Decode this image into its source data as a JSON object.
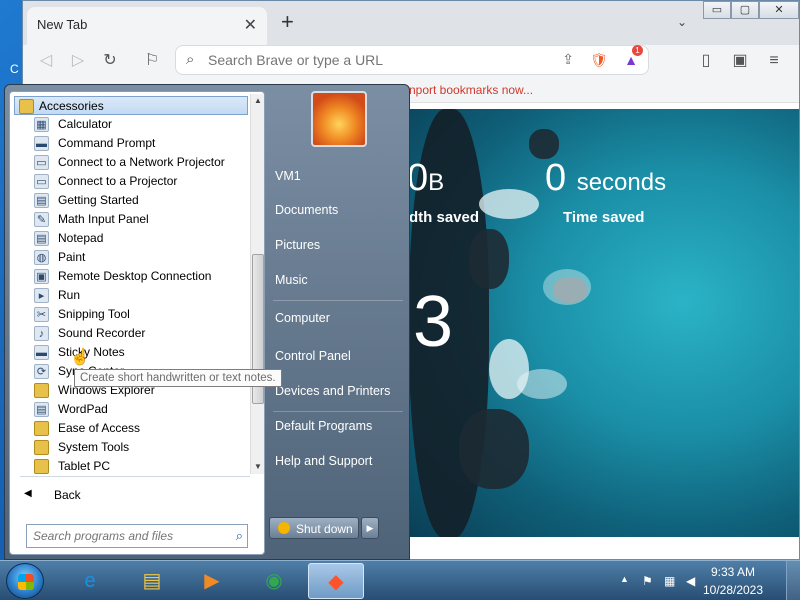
{
  "desktop": {
    "left_text": "C"
  },
  "browser": {
    "tab_title": "New Tab",
    "tab_close": "✕",
    "new_tab": "+",
    "tabs_chevron": "⌄",
    "window_controls": {
      "minimize": "▭",
      "maximize": "▢",
      "close": "✕"
    },
    "toolbar": {
      "back": "◁",
      "forward": "▷",
      "reload": "↻",
      "bookmark": "⚐",
      "search_icon": "⌕",
      "address_placeholder": "Search Brave or type a URL",
      "share": "⇪",
      "brave_shield": "🛡",
      "rewards_badge": "1",
      "sidebar": "▯",
      "wallet": "▣",
      "menu": "≡"
    },
    "bookmarks_bar": {
      "import_link": "nport bookmarks now..."
    },
    "ntp": {
      "bandwidth_value": "0",
      "bandwidth_unit": "B",
      "bandwidth_label": "dth saved",
      "time_value": "0",
      "time_unit": "seconds",
      "time_label": "Time saved",
      "big_number": "3"
    }
  },
  "start_menu": {
    "programs_header": "Accessories",
    "programs": [
      {
        "label": "Calculator",
        "icon": "calculator-icon",
        "glyph": "▦"
      },
      {
        "label": "Command Prompt",
        "icon": "command-prompt-icon",
        "glyph": "▬"
      },
      {
        "label": "Connect to a Network Projector",
        "icon": "network-projector-icon",
        "glyph": "▭"
      },
      {
        "label": "Connect to a Projector",
        "icon": "projector-icon",
        "glyph": "▭"
      },
      {
        "label": "Getting Started",
        "icon": "getting-started-icon",
        "glyph": "▤"
      },
      {
        "label": "Math Input Panel",
        "icon": "math-input-icon",
        "glyph": "✎"
      },
      {
        "label": "Notepad",
        "icon": "notepad-icon",
        "glyph": "▤"
      },
      {
        "label": "Paint",
        "icon": "paint-icon",
        "glyph": "◍"
      },
      {
        "label": "Remote Desktop Connection",
        "icon": "remote-desktop-icon",
        "glyph": "▣"
      },
      {
        "label": "Run",
        "icon": "run-icon",
        "glyph": "▸"
      },
      {
        "label": "Snipping Tool",
        "icon": "snipping-tool-icon",
        "glyph": "✂"
      },
      {
        "label": "Sound Recorder",
        "icon": "microphone-icon",
        "glyph": "♪"
      },
      {
        "label": "Sticky Notes",
        "icon": "sticky-notes-icon",
        "glyph": "▬"
      },
      {
        "label": "Sync Center",
        "icon": "sync-center-icon",
        "glyph": "⟳"
      },
      {
        "label": "Windows Explorer",
        "icon": "folder-icon",
        "glyph": ""
      },
      {
        "label": "WordPad",
        "icon": "wordpad-icon",
        "glyph": "▤"
      },
      {
        "label": "Ease of Access",
        "icon": "folder-icon",
        "glyph": ""
      },
      {
        "label": "System Tools",
        "icon": "folder-icon",
        "glyph": ""
      },
      {
        "label": "Tablet PC",
        "icon": "folder-icon",
        "glyph": ""
      }
    ],
    "back_label": "Back",
    "back_arrow": "◀",
    "search_placeholder": "Search programs and files",
    "search_icon": "⌕",
    "tooltip": "Create short handwritten or text notes.",
    "right_items": [
      "VM1",
      "Documents",
      "Pictures",
      "Music",
      "Computer",
      "Control Panel",
      "Devices and Printers",
      "Default Programs",
      "Help and Support"
    ],
    "shutdown_label": "Shut down",
    "shutdown_arrow": "▶"
  },
  "taskbar": {
    "clock_time": "9:33 AM",
    "clock_date": "10/28/2023",
    "tray_chevron": "▲",
    "apps": [
      {
        "name": "internet-explorer-icon",
        "glyph": "e",
        "color": "#1b8fe0",
        "active": false
      },
      {
        "name": "file-explorer-icon",
        "glyph": "▤",
        "color": "#f0c64a",
        "active": false
      },
      {
        "name": "media-player-icon",
        "glyph": "▶",
        "color": "#f08a24",
        "active": false
      },
      {
        "name": "chrome-icon",
        "glyph": "◉",
        "color": "#2fa84f",
        "active": false
      },
      {
        "name": "brave-icon",
        "glyph": "◆",
        "color": "#fb542b",
        "active": true
      }
    ]
  },
  "colors": {
    "accent_link": "#d0392b",
    "taskbar": "#284d73",
    "start_menu": "#5f7389"
  }
}
